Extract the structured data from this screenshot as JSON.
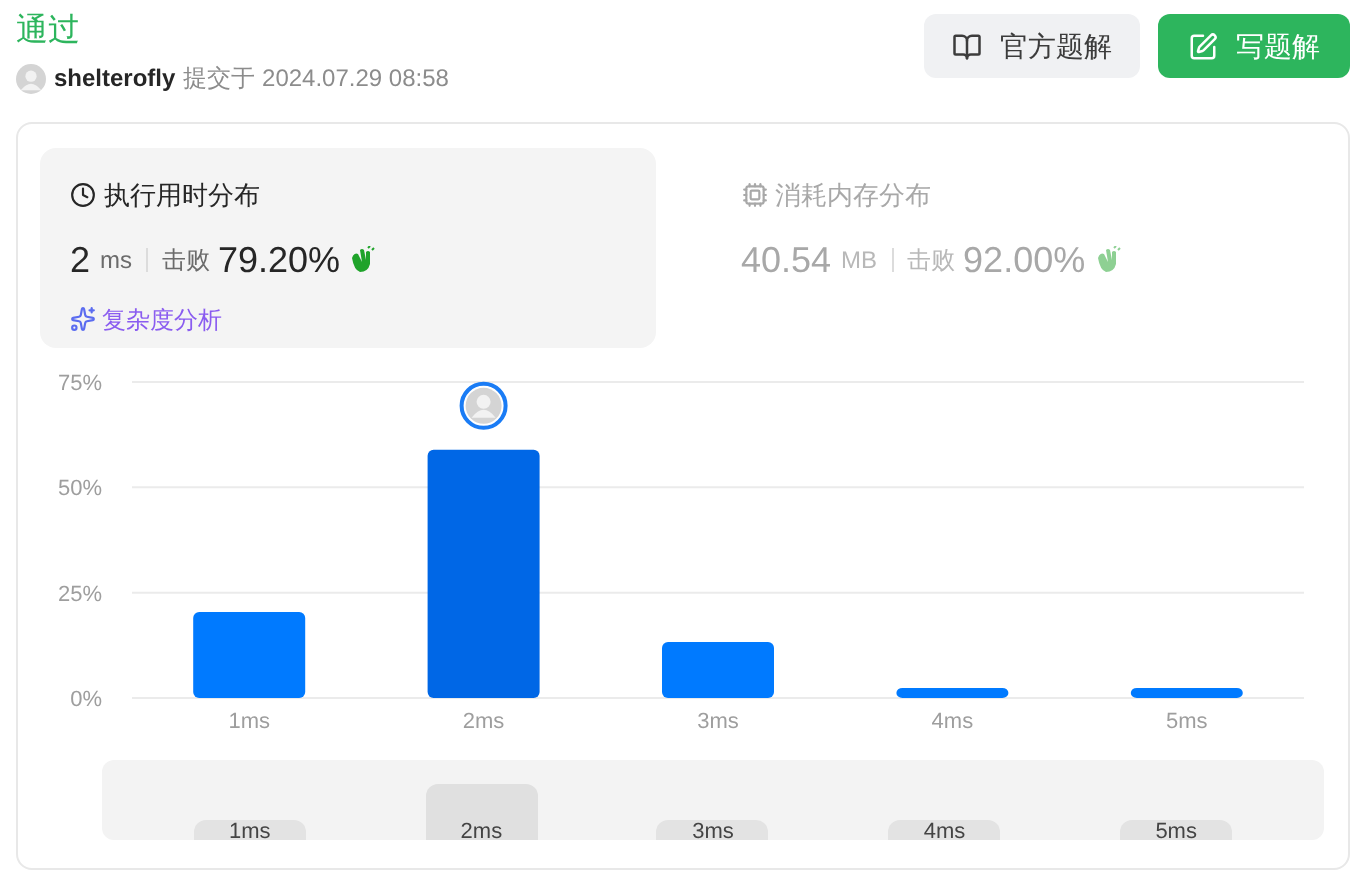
{
  "status": "通过",
  "submission": {
    "user": "shelterofly",
    "submitted_text": "提交于 2024.07.29 08:58"
  },
  "buttons": [
    {
      "label": "官方题解",
      "kind": "secondary"
    },
    {
      "label": "写题解",
      "kind": "primary"
    }
  ],
  "panels": [
    {
      "title": "执行用时分布",
      "kind": "time",
      "selected": true,
      "value": "2",
      "unit": "ms",
      "beats_label": "击败",
      "beats": "79.20%",
      "analysis_link": "复杂度分析"
    },
    {
      "title": "消耗内存分布",
      "kind": "memory",
      "selected": false,
      "value": "40.54",
      "unit": "MB",
      "beats_label": "击败",
      "beats": "92.00%"
    }
  ],
  "chart_data": {
    "type": "bar",
    "categories": [
      "1ms",
      "2ms",
      "3ms",
      "4ms",
      "5ms"
    ],
    "stacked": true,
    "series": [
      {
        "color": "#007aff",
        "values": [
          20.4,
          null,
          13.3,
          2.4,
          2.4
        ]
      },
      {
        "color": "#0067e6",
        "values": [
          null,
          58.9,
          null,
          null,
          null
        ]
      }
    ],
    "ylim": [
      0,
      75
    ],
    "yticks": [
      {
        "value": 0,
        "label": "0%"
      },
      {
        "value": 25,
        "label": "25%"
      },
      {
        "value": 50,
        "label": "50%"
      },
      {
        "value": 75,
        "label": "75%"
      }
    ]
  },
  "brush_labels": [
    "1ms",
    "2ms",
    "3ms",
    "4ms",
    "5ms"
  ]
}
